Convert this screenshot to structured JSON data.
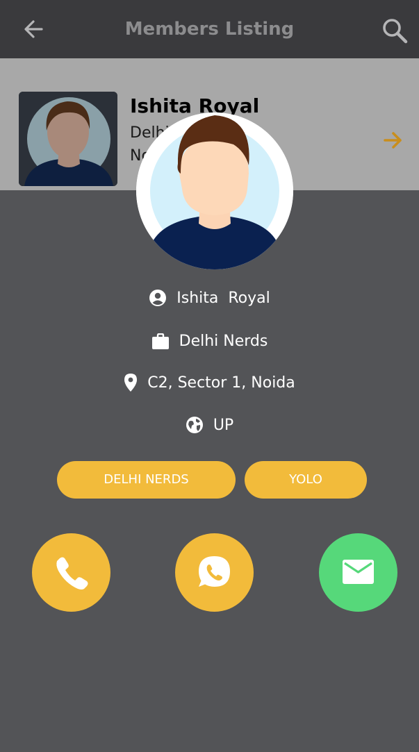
{
  "header": {
    "title": "Members Listing",
    "back_icon": "arrow-left-icon",
    "search_icon": "search-icon"
  },
  "list_row": {
    "name": "Ishita Royal",
    "group": "Delhi",
    "area": "No",
    "arrow_icon": "arrow-right-icon",
    "arrow_color": "#c98e1c"
  },
  "profile": {
    "name": "Ishita  Royal",
    "group": "Delhi Nerds",
    "address": "C2, Sector 1, Noida",
    "state": "UP",
    "icons": {
      "name": "account-circle-icon",
      "group": "briefcase-icon",
      "address": "location-pin-icon",
      "state": "globe-icon"
    }
  },
  "tags": [
    "DELHI NERDS",
    "YOLO"
  ],
  "actions": {
    "call_icon": "phone-icon",
    "whatsapp_icon": "whatsapp-icon",
    "mail_icon": "mail-icon"
  },
  "colors": {
    "accent": "#f2bb3b",
    "mail": "#56d87a",
    "background": "#535457",
    "header": "#3a3a3d"
  }
}
